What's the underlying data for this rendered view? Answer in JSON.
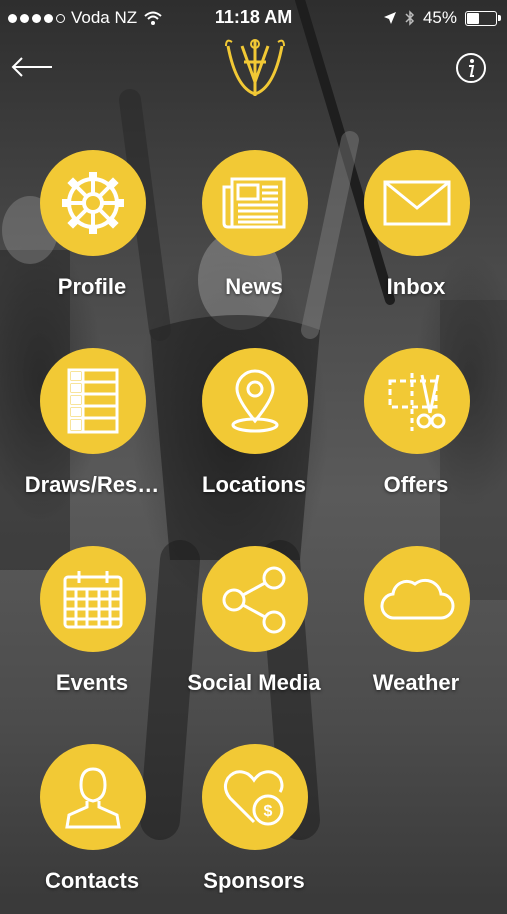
{
  "status_bar": {
    "carrier": "Voda NZ",
    "time": "11:18 AM",
    "battery": "45%",
    "battery_level": 0.45
  },
  "header": {
    "back_icon": "arrow-left-icon",
    "logo_icon": "club-monogram-logo",
    "info_icon": "info-icon"
  },
  "theme": {
    "accent": "#f2c935",
    "text": "#ffffff"
  },
  "menu": [
    {
      "label": "Profile",
      "icon": "gear-icon"
    },
    {
      "label": "News",
      "icon": "newspaper-icon"
    },
    {
      "label": "Inbox",
      "icon": "envelope-icon"
    },
    {
      "label": "Draws/Res…",
      "icon": "list-icon"
    },
    {
      "label": "Locations",
      "icon": "map-pin-icon"
    },
    {
      "label": "Offers",
      "icon": "coupon-scissors-icon"
    },
    {
      "label": "Events",
      "icon": "calendar-icon"
    },
    {
      "label": "Social Media",
      "icon": "share-icon"
    },
    {
      "label": "Weather",
      "icon": "cloud-icon"
    },
    {
      "label": "Contacts",
      "icon": "person-icon"
    },
    {
      "label": "Sponsors",
      "icon": "heart-dollar-icon"
    }
  ]
}
